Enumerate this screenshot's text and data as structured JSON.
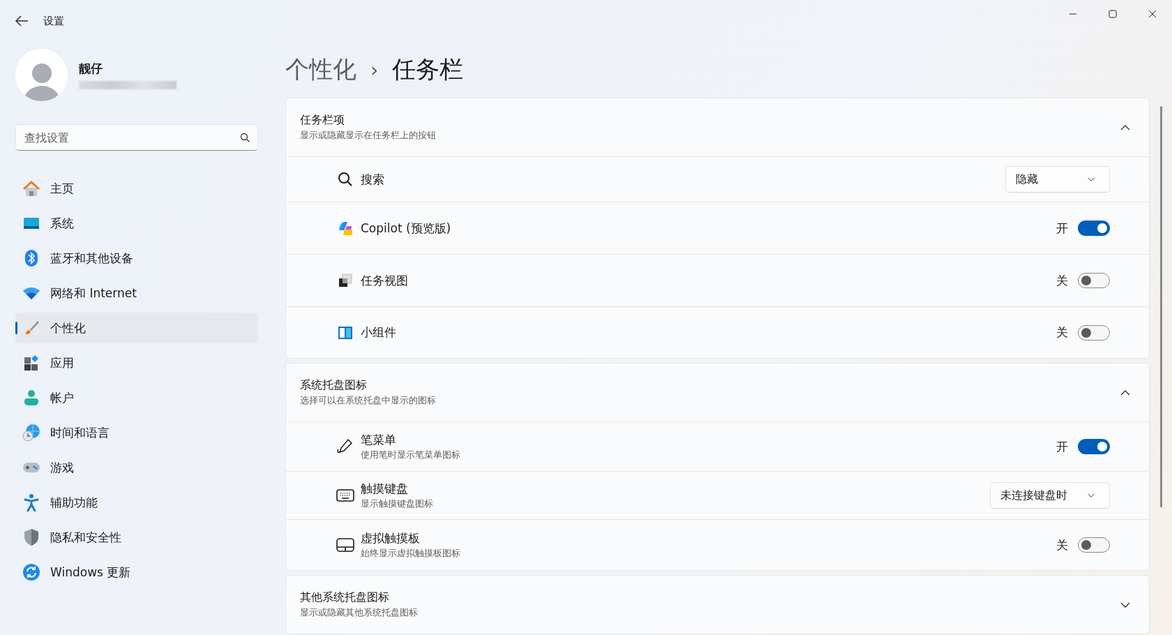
{
  "window": {
    "title": "设置"
  },
  "account": {
    "name": "靓仔"
  },
  "search": {
    "placeholder": "查找设置"
  },
  "sidebar": {
    "items": [
      {
        "kind": "home",
        "label": "主页",
        "selected": false
      },
      {
        "kind": "system",
        "label": "系统",
        "selected": false
      },
      {
        "kind": "bluetooth",
        "label": "蓝牙和其他设备",
        "selected": false
      },
      {
        "kind": "network",
        "label": "网络和 Internet",
        "selected": false
      },
      {
        "kind": "personalization",
        "label": "个性化",
        "selected": true
      },
      {
        "kind": "apps",
        "label": "应用",
        "selected": false
      },
      {
        "kind": "accounts",
        "label": "帐户",
        "selected": false
      },
      {
        "kind": "time",
        "label": "时间和语言",
        "selected": false
      },
      {
        "kind": "gaming",
        "label": "游戏",
        "selected": false
      },
      {
        "kind": "accessibility",
        "label": "辅助功能",
        "selected": false
      },
      {
        "kind": "privacy",
        "label": "隐私和安全性",
        "selected": false
      },
      {
        "kind": "update",
        "label": "Windows 更新",
        "selected": false
      }
    ]
  },
  "breadcrumb": {
    "parent": "个性化",
    "separator": "›",
    "current": "任务栏"
  },
  "sections": [
    {
      "title": "任务栏项",
      "subtitle": "显示或隐藏显示在任务栏上的按钮",
      "expanded": true,
      "rows": [
        {
          "kind": "dropdown",
          "label": "搜索",
          "value": "隐藏"
        },
        {
          "kind": "toggle",
          "label": "Copilot (预览版)",
          "on": true,
          "state_label": "开"
        },
        {
          "kind": "toggle",
          "label": "任务视图",
          "on": false,
          "state_label": "关"
        },
        {
          "kind": "toggle",
          "label": "小组件",
          "on": false,
          "state_label": "关"
        }
      ]
    },
    {
      "title": "系统托盘图标",
      "subtitle": "选择可以在系统托盘中显示的图标",
      "expanded": true,
      "rows": [
        {
          "kind": "toggle",
          "label": "笔菜单",
          "description": "使用笔时显示笔菜单图标",
          "on": true,
          "state_label": "开"
        },
        {
          "kind": "dropdown",
          "label": "触摸键盘",
          "description": "显示触摸键盘图标",
          "value": "未连接键盘时"
        },
        {
          "kind": "toggle",
          "label": "虚拟触摸板",
          "description": "始终显示虚拟触摸板图标",
          "on": false,
          "state_label": "关"
        }
      ]
    },
    {
      "title": "其他系统托盘图标",
      "subtitle": "显示或隐藏其他系统托盘图标",
      "expanded": false
    }
  ]
}
